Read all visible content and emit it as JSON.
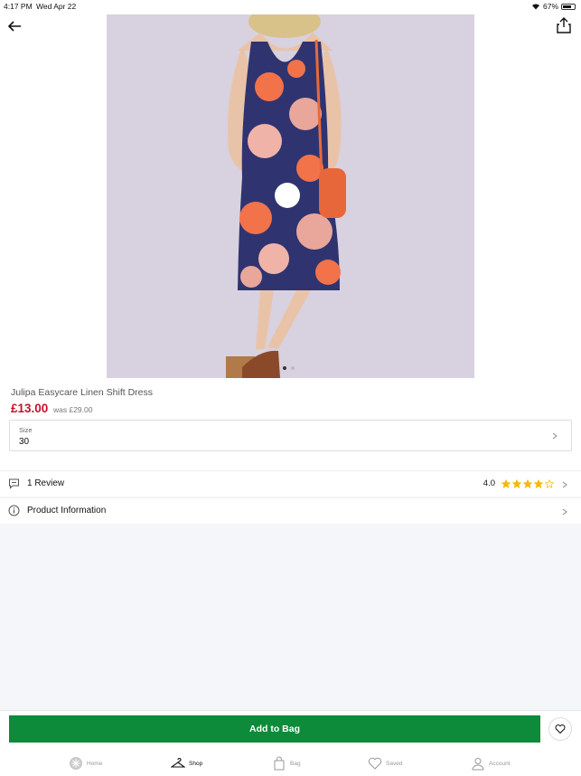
{
  "status": {
    "time": "4:17 PM",
    "date": "Wed Apr 22",
    "battery": "67%"
  },
  "product": {
    "title": "Julipa Easycare Linen Shift Dress",
    "price": "£13.00",
    "was_price": "was £29.00",
    "image_pages": 2,
    "current_image": 1
  },
  "size": {
    "label": "Size",
    "value": "30"
  },
  "reviews": {
    "label": "1 Review",
    "rating_text": "4.0",
    "rating": 4,
    "max": 5
  },
  "product_info": {
    "label": "Product Information"
  },
  "actions": {
    "add_to_bag": "Add to Bag"
  },
  "tabs": [
    {
      "label": "Home",
      "icon": "home-icon"
    },
    {
      "label": "Shop",
      "icon": "hanger-icon"
    },
    {
      "label": "Bag",
      "icon": "bag-icon"
    },
    {
      "label": "Saved",
      "icon": "heart-icon"
    },
    {
      "label": "Account",
      "icon": "account-icon"
    }
  ],
  "colors": {
    "price": "#c4122f",
    "add_button": "#0d8a3a",
    "star": "#f5b800"
  }
}
